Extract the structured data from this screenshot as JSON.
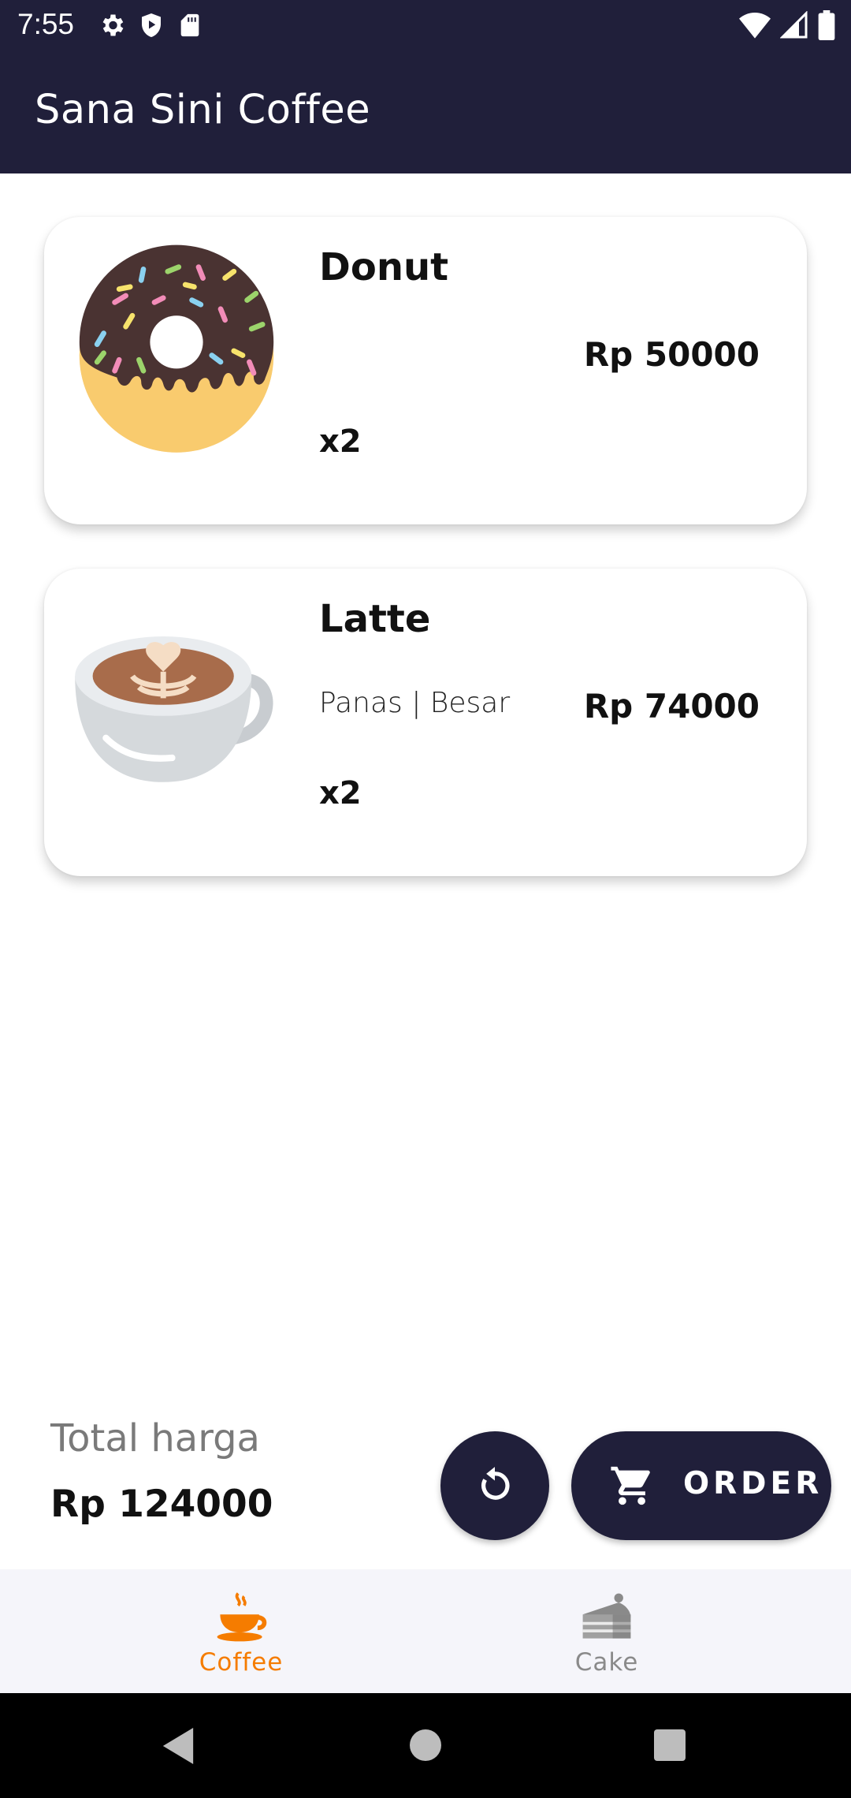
{
  "status_bar": {
    "time": "7:55",
    "left_icons": [
      "gear-icon",
      "shield-play-icon",
      "sd-card-icon"
    ],
    "right_icons": [
      "wifi-icon",
      "cellular-signal-icon",
      "battery-icon"
    ]
  },
  "app_bar": {
    "title": "Sana Sini Coffee",
    "background": "#201f3a"
  },
  "cart_items": [
    {
      "name": "Donut",
      "options": "",
      "price": "Rp 50000",
      "quantity": "x2",
      "icon": "donut-icon"
    },
    {
      "name": "Latte",
      "options": "Panas | Besar",
      "price": "Rp 74000",
      "quantity": "x2",
      "icon": "latte-cup-icon"
    }
  ],
  "footer": {
    "total_label": "Total harga",
    "total_value": "Rp 124000",
    "reset_icon": "refresh-icon",
    "order_icon": "cart-icon",
    "order_label": "ORDER"
  },
  "bottom_nav": {
    "items": [
      {
        "label": "Coffee",
        "icon": "coffee-cup-icon",
        "active": true,
        "color": "#f57c00"
      },
      {
        "label": "Cake",
        "icon": "cake-slice-icon",
        "active": false,
        "color": "#8a8a8a"
      }
    ]
  },
  "system_nav": {
    "buttons": [
      "back-icon",
      "home-icon",
      "recents-icon"
    ]
  }
}
